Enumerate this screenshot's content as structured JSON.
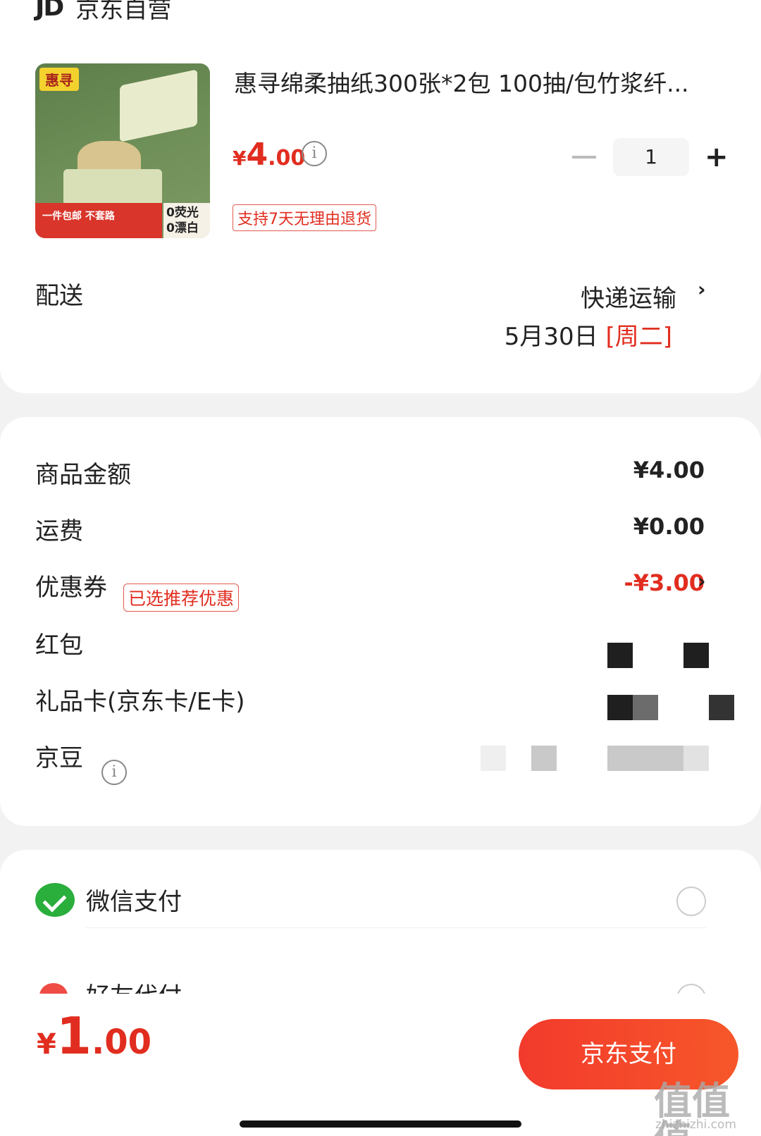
{
  "shop": {
    "logo": "JD",
    "name": "京东自营"
  },
  "product": {
    "image_tag": "惠寻",
    "image_strip": "一件包邮 不套路",
    "image_badge": "0荧光 0漂白",
    "title": "惠寻绵柔抽纸300张*2包 100抽/包竹浆纤...",
    "price_currency": "¥",
    "price_int": "4",
    "price_dec": ".00",
    "quantity": "1",
    "minus": "−",
    "plus": "+",
    "return_tag": "支持7天无理由退货"
  },
  "delivery": {
    "label": "配送",
    "method": "快递运输",
    "date": "5月30日",
    "weekday": "[周二]"
  },
  "summary": {
    "goods_label": "商品金额",
    "goods_value": "¥4.00",
    "shipping_label": "运费",
    "shipping_value": "¥0.00",
    "coupon_label": "优惠券",
    "coupon_tag": "已选推荐优惠",
    "coupon_value": "-¥3.00",
    "redpacket_label": "红包",
    "giftcard_label": "礼品卡(京东卡/E卡)",
    "jingdou_label": "京豆"
  },
  "payment": {
    "wechat_label": "微信支付",
    "friend_label": "好友代付"
  },
  "footer": {
    "total_currency": "¥",
    "total_int": "1",
    "total_dec": ".00",
    "pay_button": "京东支付"
  },
  "watermark": {
    "main": "值值值",
    "sub": "zhizhizhi.com"
  },
  "colors": {
    "accent": "#e12d1f",
    "wechat": "#2aae3c",
    "button": "#f23a2c"
  },
  "chevron": "›",
  "info_glyph": "i"
}
